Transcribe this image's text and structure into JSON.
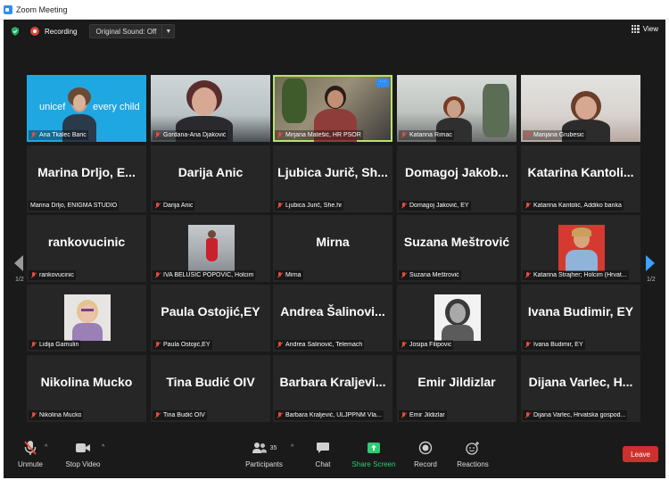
{
  "window": {
    "title": "Zoom Meeting"
  },
  "topbar": {
    "recording_label": "Recording",
    "original_sound_label": "Original Sound: Off",
    "view_label": "View"
  },
  "pager": {
    "left": "1/2",
    "right": "1/2"
  },
  "tiles": [
    {
      "label": "Ana Tkalec Baric",
      "big": ""
    },
    {
      "label": "Gordana-Ana Djaković",
      "big": ""
    },
    {
      "label": "Mirjana Matešić, HR PSOR",
      "big": ""
    },
    {
      "label": "Katarina Rimac",
      "big": ""
    },
    {
      "label": "Marijana Grubesic",
      "big": ""
    },
    {
      "label": "Marina Drljo, ENIGMA STUDIO",
      "big": "Marina Drljo, E..."
    },
    {
      "label": "Darija Anic",
      "big": "Darija Anic"
    },
    {
      "label": "Ljubica Jurič, She.hr",
      "big": "Ljubica Jurič, Sh..."
    },
    {
      "label": "Domagoj Jaković, EY",
      "big": "Domagoj Jakob..."
    },
    {
      "label": "Katarina Kantolić, Addiko banka",
      "big": "Katarina Kantoli..."
    },
    {
      "label": "rankovucinic",
      "big": "rankovucinic"
    },
    {
      "label": "IVA BELUŠIĆ POPOVIĆ, Holcim",
      "big": ""
    },
    {
      "label": "Mirna",
      "big": "Mirna"
    },
    {
      "label": "Suzana Meštrović",
      "big": "Suzana Meštrović"
    },
    {
      "label": "Katarina Strajher; Holcim (Hrvat...",
      "big": ""
    },
    {
      "label": "Lidija Gamulin",
      "big": ""
    },
    {
      "label": "Paula Ostojić,EY",
      "big": "Paula Ostojić,EY"
    },
    {
      "label": "Andrea Šalinović, Telemach",
      "big": "Andrea Šalinovi..."
    },
    {
      "label": "Josipa Filipovic",
      "big": ""
    },
    {
      "label": "Ivana Budimir, EY",
      "big": "Ivana Budimir, EY"
    },
    {
      "label": "Nikolina Mucko",
      "big": "Nikolina Mucko"
    },
    {
      "label": "Tina Budić OIV",
      "big": "Tina Budić OIV"
    },
    {
      "label": "Barbara Kraljević, ULJPPNM Vla...",
      "big": "Barbara Kraljevi..."
    },
    {
      "label": "Emir Jildizlar",
      "big": "Emir Jildizlar"
    },
    {
      "label": "Dijana Varlec, Hrvatska gospod...",
      "big": "Dijana Varlec, H..."
    }
  ],
  "unicef": {
    "word1": "unicef",
    "word2": "every child"
  },
  "toolbar": {
    "unmute": "Unmute",
    "stop_video": "Stop Video",
    "participants": "Participants",
    "participants_count": "35",
    "chat": "Chat",
    "share_screen": "Share Screen",
    "record": "Record",
    "reactions": "Reactions",
    "leave": "Leave"
  },
  "colors": {
    "accent_blue": "#2d8cff",
    "share_green": "#2ecc71",
    "leave_red": "#cf2f2f",
    "active_speaker": "#b7e36a"
  }
}
